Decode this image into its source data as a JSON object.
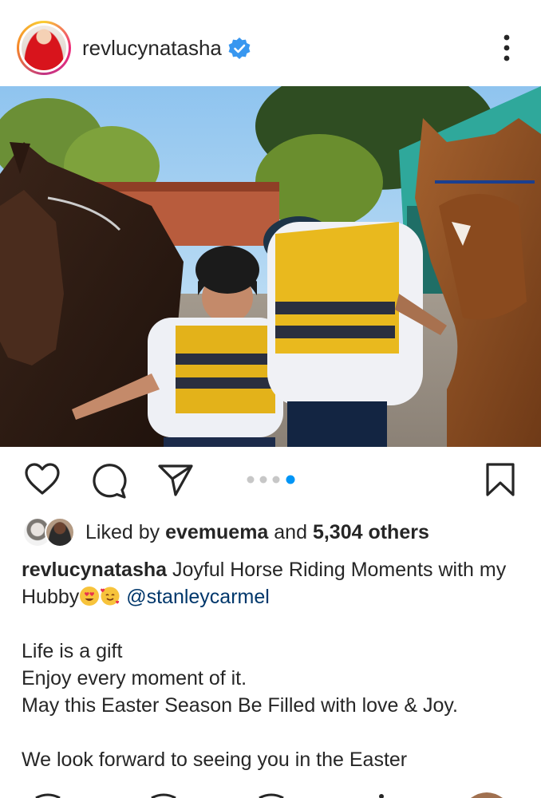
{
  "header": {
    "username": "revlucynatasha",
    "verified_icon": "verified-badge-icon",
    "more_icon": "more-vertical-icon"
  },
  "photo": {
    "description_icon": "post-photo"
  },
  "actions": {
    "like_icon": "heart-icon",
    "comment_icon": "comment-icon",
    "share_icon": "send-icon",
    "save_icon": "bookmark-icon",
    "carousel_total": 4,
    "carousel_active": 4
  },
  "likes": {
    "prefix": "Liked by",
    "first_liker": "evemuema",
    "conjunction": "and",
    "others": "5,304 others"
  },
  "caption": {
    "author": "revlucynatasha",
    "text_line1": "Joyful Horse Riding Moments with my",
    "text_line2": "Hubby",
    "mention": "@stanleycarmel",
    "line3": "Life is a gift",
    "line4": "Enjoy every moment of it.",
    "line5": "May this Easter Season Be Filled with love & Joy.",
    "line6": "We look forward to seeing you in the Easter"
  },
  "colors": {
    "verified": "#3897f0",
    "mention": "#00376b",
    "dot_active": "#0095f6",
    "dot_inactive": "#c7c7c7"
  }
}
